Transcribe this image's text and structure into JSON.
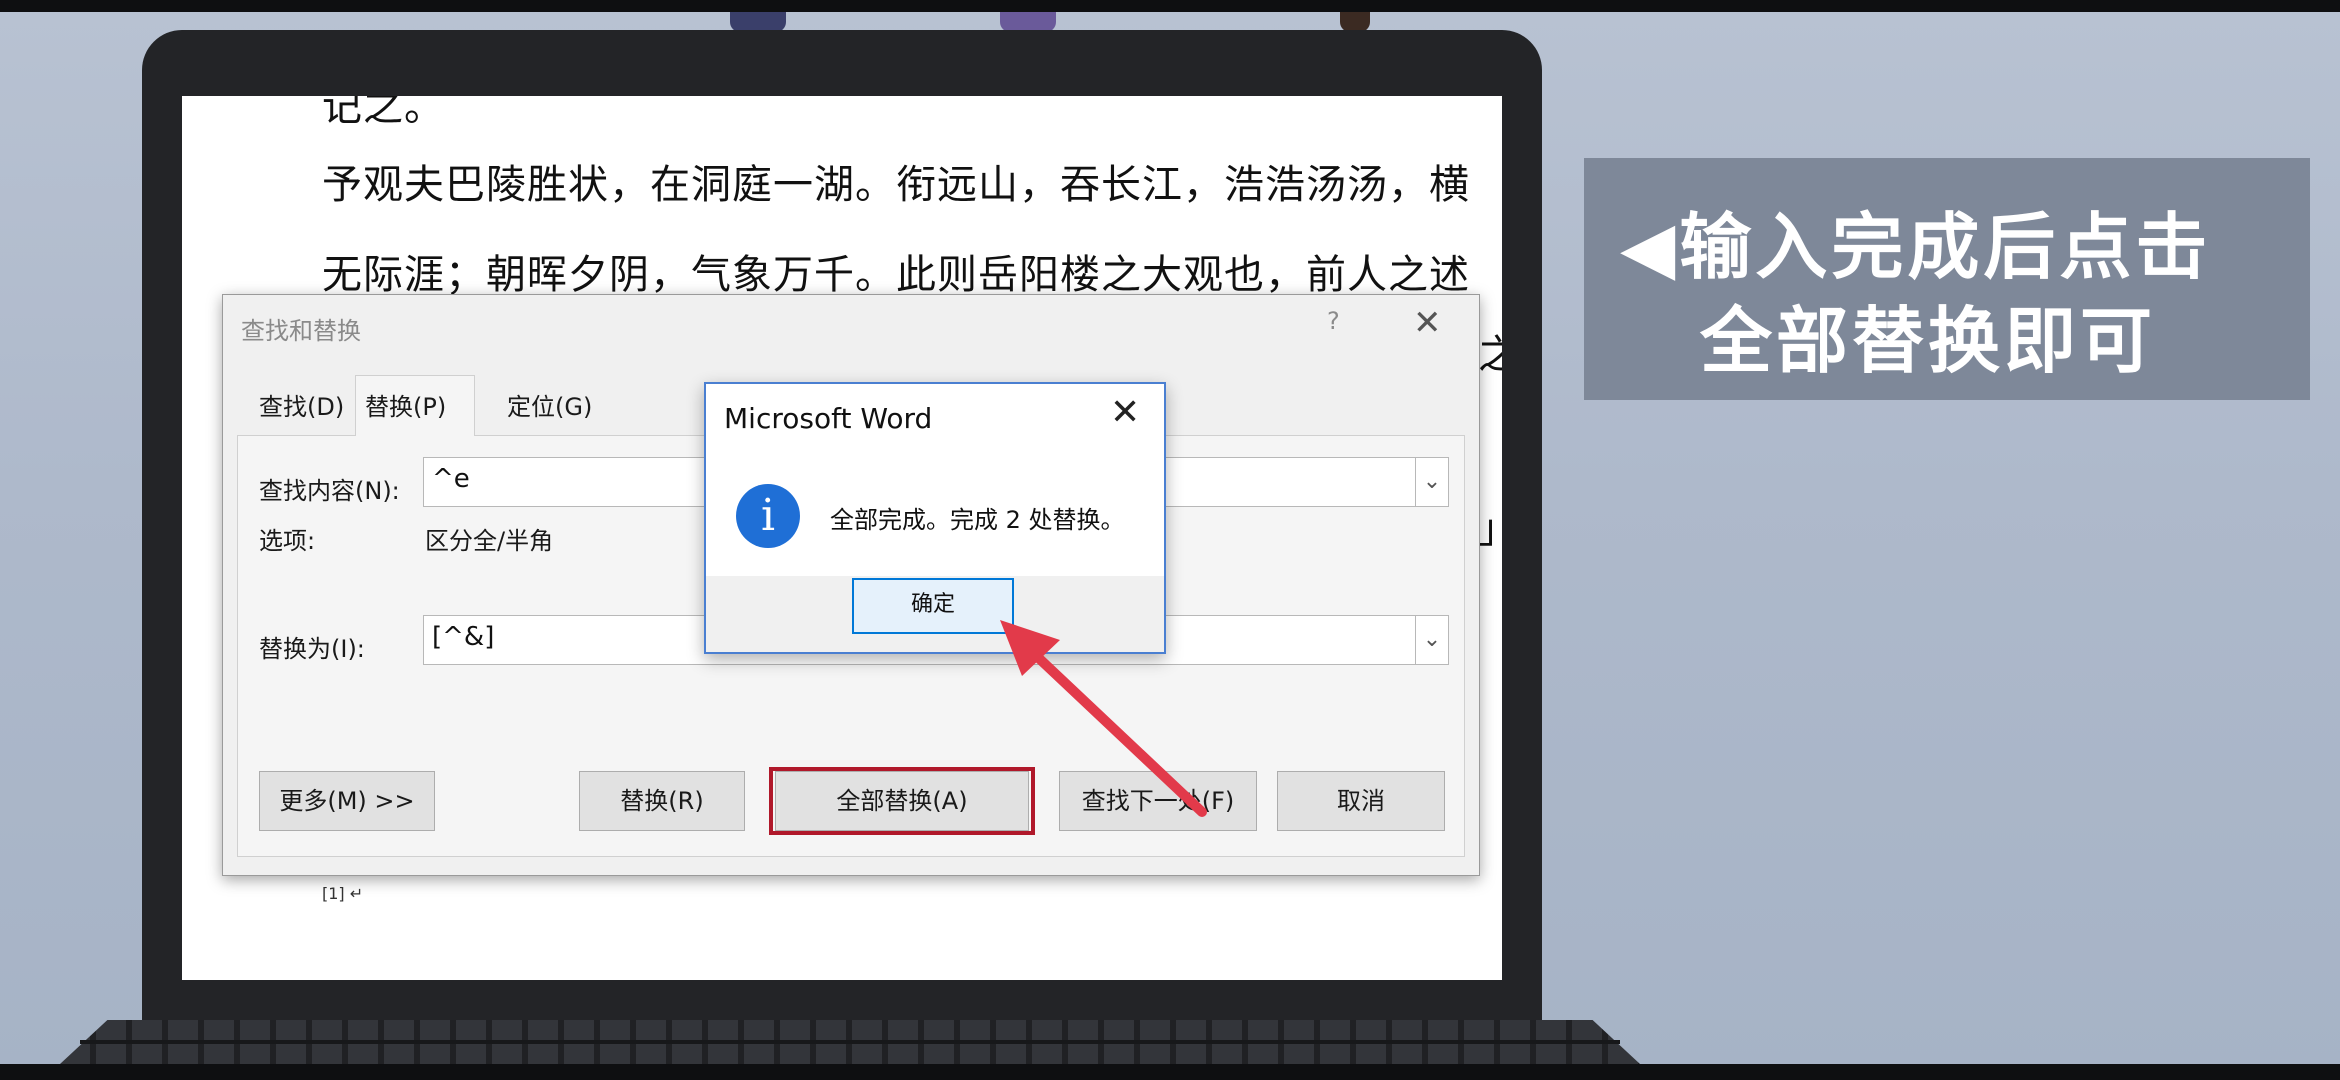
{
  "document": {
    "line_top_fragment": "记之。",
    "line1": "予观夫巴陵胜状，在洞庭一湖。衔远山，吞长江，浩浩汤汤，横",
    "line2": "无际涯；朝晖夕阴，气象万千。此则岳阳楼之大观也，前人之述",
    "edge_char_1": "之",
    "edge_char_2": "」",
    "footnote_mark": "[1] ↵"
  },
  "find_replace_dialog": {
    "title": "查找和替换",
    "help_label": "?",
    "close_label": "✕",
    "tabs": [
      {
        "label": "查找(D)",
        "active": false
      },
      {
        "label": "替换(P)",
        "active": true
      },
      {
        "label": "定位(G)",
        "active": false
      }
    ],
    "find_label": "查找内容(N):",
    "find_value": "^e",
    "options_label": "选项:",
    "options_value": "区分全/半角",
    "replace_label": "替换为(I):",
    "replace_value": "[^&]",
    "buttons": {
      "more": "更多(M) >>",
      "replace": "替换(R)",
      "replace_all": "全部替换(A)",
      "find_next": "查找下一处(F)",
      "cancel": "取消"
    }
  },
  "message_box": {
    "title": "Microsoft Word",
    "close_label": "✕",
    "icon": "info-icon",
    "icon_glyph": "i",
    "message": "全部完成。完成 2 处替换。",
    "ok_label": "确定"
  },
  "caption": {
    "line1": "◀输入完成后点击",
    "line2": "全部替换即可",
    "background_color": "#7e8899"
  },
  "colors": {
    "highlight_border": "#b0182a",
    "arrow": "#e23a4a",
    "info_blue": "#1f6fd6"
  }
}
